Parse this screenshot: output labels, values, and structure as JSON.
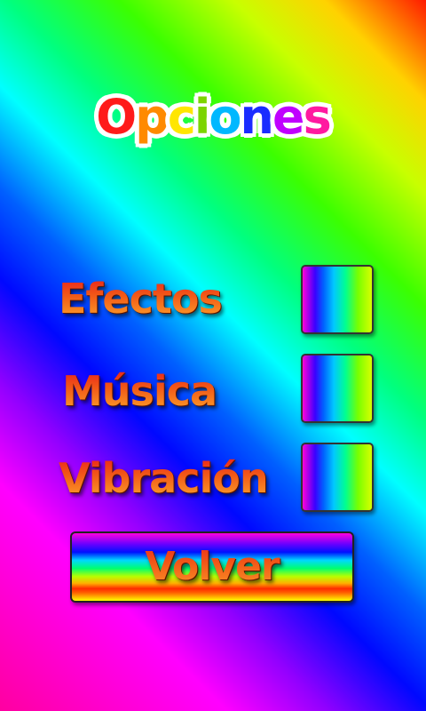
{
  "title": {
    "text": "Opciones",
    "letters": [
      {
        "char": "O",
        "color": "#ff1a1a"
      },
      {
        "char": "p",
        "color": "#ff8a00"
      },
      {
        "char": "c",
        "color": "#ffe600"
      },
      {
        "char": "i",
        "color": "#7cd400"
      },
      {
        "char": "o",
        "color": "#00b8ff"
      },
      {
        "char": "n",
        "color": "#1a2cff"
      },
      {
        "char": "e",
        "color": "#c000ff"
      },
      {
        "char": "s",
        "color": "#ff1aa0"
      }
    ]
  },
  "options": [
    {
      "label": "Efectos"
    },
    {
      "label": "Música"
    },
    {
      "label": "Vibración"
    }
  ],
  "back_button": {
    "label": "Volver"
  }
}
